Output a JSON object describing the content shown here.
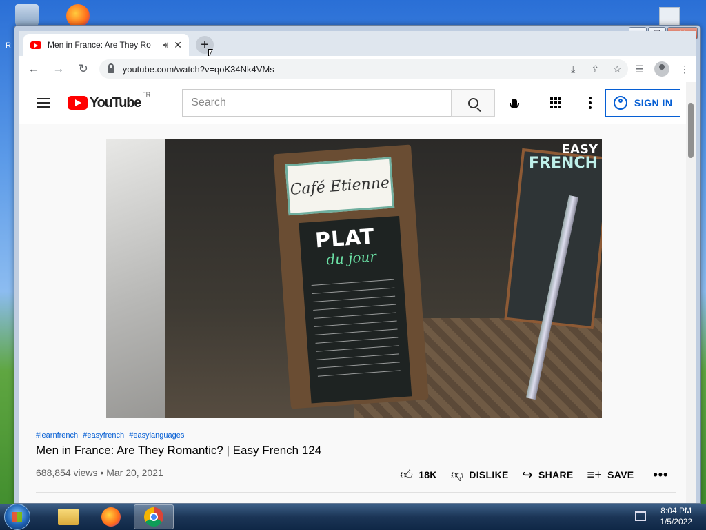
{
  "desktop": {
    "left_label": "R",
    "right_label": ""
  },
  "browser": {
    "tab": {
      "title": "Men in France: Are They Ro",
      "audio_icon": "speaker-icon",
      "close": "✕"
    },
    "new_tab": "+",
    "nav": {
      "back": "←",
      "forward": "→",
      "reload": "↻"
    },
    "url": "youtube.com/watch?v=qoK34Nk4VMs",
    "omnibox_icons": [
      "install-icon",
      "share-icon",
      "bookmark-star-icon"
    ],
    "toolbar_icons": [
      "reading-list-icon",
      "profile-icon",
      "menu-icon"
    ]
  },
  "youtube": {
    "logo_text": "YouTube",
    "region": "FR",
    "search_placeholder": "Search",
    "sign_in": "SIGN IN",
    "video": {
      "hashtags": [
        "#learnfrench",
        "#easyfrench",
        "#easylanguages"
      ],
      "title": "Men in France: Are They Romantic? | Easy French 124",
      "views": "688,854 views",
      "date": "Mar 20, 2021",
      "likes": "18K",
      "dislike_label": "DISLIKE",
      "share_label": "SHARE",
      "save_label": "SAVE",
      "thumbnail": {
        "sign": "Café Etienne",
        "chalk_title": "PLAT",
        "chalk_sub": "du jour",
        "badge_line1": "EASY",
        "badge_line2": "FRENCH"
      }
    }
  },
  "taskbar": {
    "time": "8:04 PM",
    "date": "1/5/2022"
  },
  "colors": {
    "yt_red": "#ff0000",
    "link_blue": "#065fd4"
  }
}
